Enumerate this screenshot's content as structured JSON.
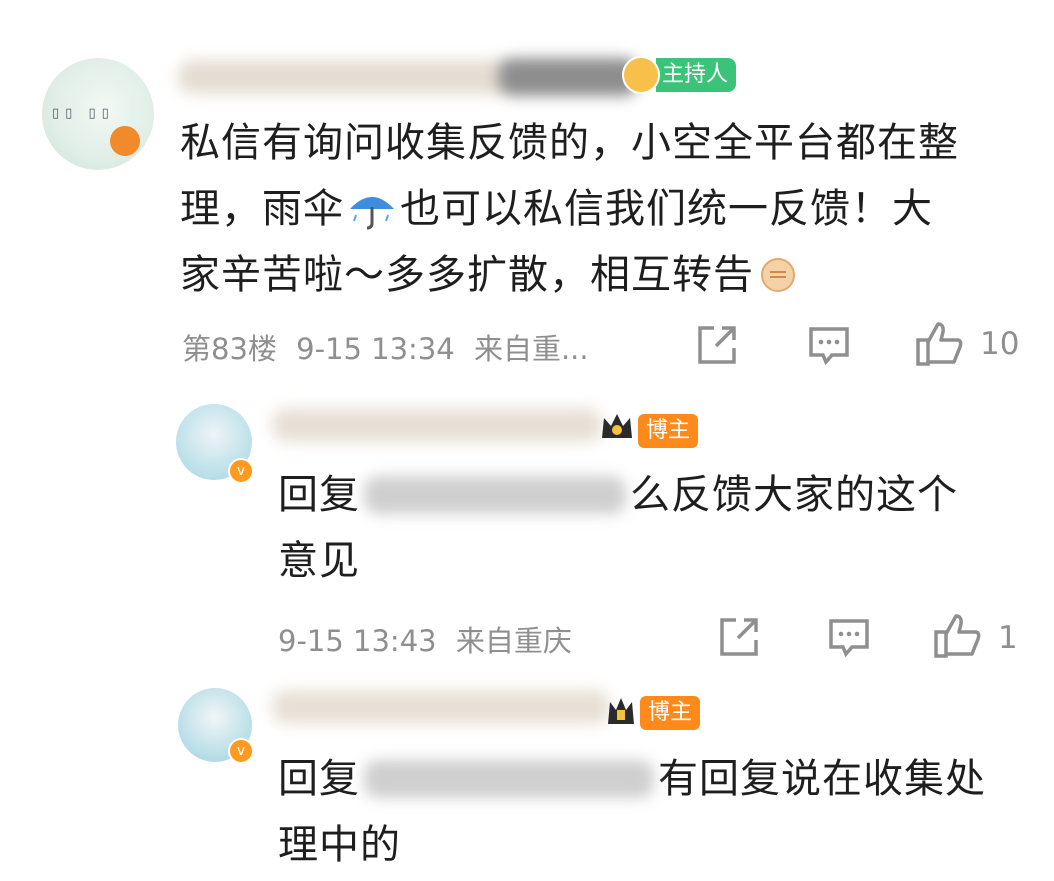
{
  "comments": [
    {
      "badge": "主持人",
      "text_lines": [
        "私信有询问收集反馈的，小空全平台都在整",
        "理，雨伞",
        "也可以私信我们统一反馈！大",
        "家辛苦啦～多多扩散，相互转告"
      ],
      "floor": "第83楼",
      "time": "9-15 13:34",
      "location": "来自重...",
      "likes": "10"
    }
  ],
  "replies": [
    {
      "badge": "博主",
      "prefix": "回复",
      "text_tail": "么反馈大家的这个",
      "text_line2": "意见",
      "time": "9-15 13:43",
      "location": "来自重庆",
      "likes": "1"
    },
    {
      "badge": "博主",
      "prefix": "回复",
      "text_tail": "有回复说在收集处",
      "text_line2": "理中的"
    }
  ],
  "icons": {
    "umbrella": "umbrella-with-rain-icon",
    "fist": "fist-icon",
    "share": "share-icon",
    "comment": "comment-icon",
    "like": "thumbs-up-icon",
    "verified": "verified-v-icon",
    "crown": "crown-icon"
  },
  "colors": {
    "host_badge": "#3cc37a",
    "owner_badge": "#ff8a1c",
    "meta_text": "#8f8f8f"
  }
}
